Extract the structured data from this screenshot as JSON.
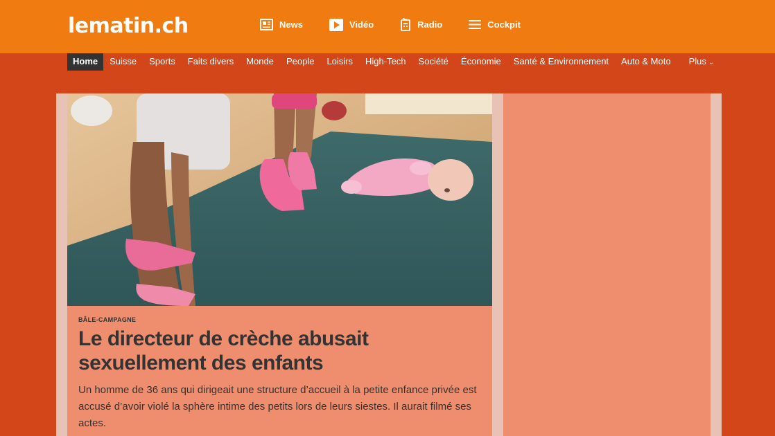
{
  "header": {
    "logo": "lematin.ch",
    "topnav": [
      {
        "label": "News",
        "icon": "newspaper-icon"
      },
      {
        "label": "Vidéo",
        "icon": "play-icon"
      },
      {
        "label": "Radio",
        "icon": "radio-icon"
      },
      {
        "label": "Cockpit",
        "icon": "menu-lines-icon"
      }
    ],
    "brand_color": "#ef7b11"
  },
  "categories": [
    "Home",
    "Suisse",
    "Sports",
    "Faits divers",
    "Monde",
    "People",
    "Loisirs",
    "High-Tech",
    "Société",
    "Économie",
    "Santé & Environnement",
    "Auto & Moto",
    "Plus"
  ],
  "active_category": "Home",
  "hero": {
    "kicker": "BÂLE-CAMPAGNE",
    "headline": "Le directeur de crèche abusait sexuellement des enfants",
    "lead": "Un homme de 36 ans qui dirigeait une structure d’accueil à la petite enfance privée est accusé d’avoir violé la sphère intime des petits lors de leurs siestes. Il aurait filmé ses actes."
  },
  "colors": {
    "page_bg": "#d24619",
    "card_bg": "#ef8e6e",
    "text": "#333333"
  }
}
